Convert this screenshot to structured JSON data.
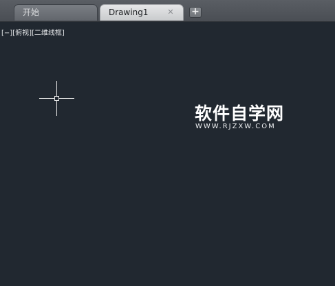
{
  "tabs": [
    {
      "label": "开始",
      "active": false
    },
    {
      "label": "Drawing1",
      "active": true,
      "close_glyph": "✕"
    }
  ],
  "new_tab_glyph": "+",
  "viewport": {
    "minus": "[−]",
    "view": "[俯视]",
    "style": "[二维线框]"
  },
  "watermark": {
    "title": "软件自学网",
    "url": "WWW.RJZXW.COM"
  },
  "colors": {
    "background": "#212830",
    "crosshair": "#e8e8e8"
  }
}
